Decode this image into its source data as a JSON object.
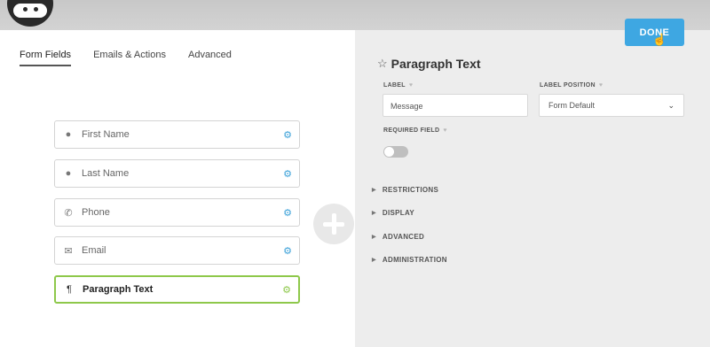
{
  "tabs": [
    {
      "label": "Form Fields",
      "active": true
    },
    {
      "label": "Emails & Actions"
    },
    {
      "label": "Advanced"
    }
  ],
  "fields": [
    {
      "label": "First Name",
      "icon": "user-icon"
    },
    {
      "label": "Last Name",
      "icon": "user-icon"
    },
    {
      "label": "Phone",
      "icon": "phone-icon"
    },
    {
      "label": "Email",
      "icon": "envelope-icon"
    },
    {
      "label": "Paragraph Text",
      "icon": "pilcrow-icon",
      "active": true
    }
  ],
  "done_button": "DONE",
  "panel": {
    "title": "Paragraph Text",
    "label_caption": "LABEL",
    "label_value": "Message",
    "label_position_caption": "LABEL POSITION",
    "label_position_value": "Form Default",
    "required_caption": "REQUIRED FIELD",
    "required_on": false,
    "sections": [
      "RESTRICTIONS",
      "DISPLAY",
      "ADVANCED",
      "ADMINISTRATION"
    ]
  },
  "colors": {
    "accent": "#3ea7e2",
    "active_field": "#8ec84b"
  }
}
